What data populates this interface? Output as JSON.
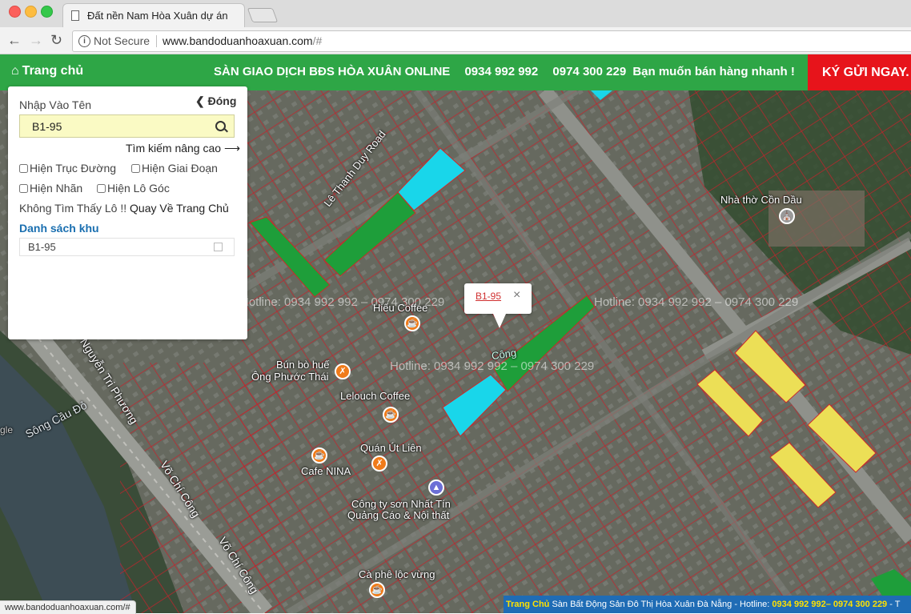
{
  "browser": {
    "tab_title": "Đất nền Nam Hòa Xuân dự án",
    "security_label": "Not Secure",
    "url_host": "www.bandoduanhoaxuan.com",
    "url_path": "/#"
  },
  "site_nav": {
    "home_label": "Trang chủ",
    "banner_title": "SÀN GIAO DỊCH BĐS HÒA XUÂN ONLINE",
    "phone_1": "0934 992 992",
    "phone_2": "0974 300 229",
    "banner_tagline": "Bạn muốn bán hàng nhanh !",
    "cta_label": "KÝ GỬI NGAY."
  },
  "panel": {
    "title": "Nhập Vào Tên",
    "close_label": "Đóng",
    "search_value": "B1-95",
    "advanced_search": "Tìm kiếm nâng cao",
    "checkboxes": {
      "road": "Hiện Trục Đường",
      "phase": "Hiện Giai Đoạn",
      "label": "Hiện Nhãn",
      "corner": "Hiện Lô Góc"
    },
    "not_found_prefix": "Không Tìm Thấy Lô !!",
    "not_found_link": "Quay Về Trang Chủ",
    "list_title": "Danh sách khu",
    "list_items": [
      "B1-95"
    ]
  },
  "map": {
    "popup_label": "B1-95",
    "watermark": "Hotline: 0934 992 992 – 0974 300 229",
    "labels": {
      "street_1": "Lê Thanh Duy Road",
      "street_2": "Nguyễn Tri Phương",
      "street_3": "Võ Chí Công",
      "street_4": "Võ Chí Công",
      "river": "Sông Cầu Đỏ",
      "church": "Nhà thờ Cồn Dầu",
      "poi_1": "Hiếu Coffee",
      "poi_2a": "Bún bò huế",
      "poi_2b": "Ông Phước Thái",
      "poi_3": "Lelouch Coffee",
      "poi_4": "Quán Út Liên",
      "poi_5": "Cafe NINA",
      "poi_6a": "Công ty sơn Nhất Tín",
      "poi_6b": "Quảng Cáo & Nội thất",
      "poi_7": "Cà phê lộc vừng",
      "partial_1": "Công",
      "partial_2": "gle"
    },
    "colors": {
      "highlight_green": "#1e9e3a",
      "highlight_cyan": "#19d6ea",
      "highlight_yellow": "#ecdf56",
      "parcel_border": "#e0202a"
    }
  },
  "status_bar": "www.bandoduanhoaxuan.com/#",
  "footer": {
    "home": "Trang Chủ",
    "text": "Sàn Bất Động Sản Đô Thị Hòa Xuân Đà Nẵng - Hotline:",
    "phones": "0934 992 992– 0974 300 229",
    "trail": "- T"
  }
}
